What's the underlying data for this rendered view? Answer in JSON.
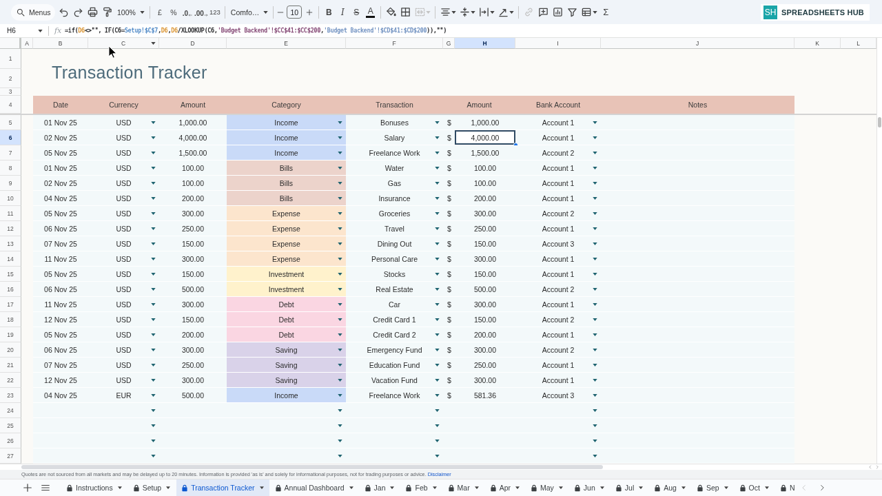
{
  "toolbar": {
    "menu_search": "Menus",
    "zoom": "100%",
    "currency": "£",
    "percent": "%",
    "decrease_decimals": ".0",
    "increase_decimals": ".00",
    "number_format": "123",
    "font": "Comfo…",
    "font_size": "10",
    "bold": "B",
    "italic": "I",
    "strikethrough": "S",
    "text_color": "A",
    "functions": "Σ",
    "merge_disabled": true,
    "link_disabled": true
  },
  "logo": {
    "mark": "SH",
    "name": "SPREADSHEETS HUB"
  },
  "formula_bar": {
    "cell": "H6",
    "fx": "fx",
    "formula": [
      {
        "text": "=if("
      },
      {
        "text": "D6",
        "color": "#d9922e"
      },
      {
        "text": "<>\"\", IF(C6="
      },
      {
        "text": "Setup!$C$7",
        "color": "#4a86c5"
      },
      {
        "text": ","
      },
      {
        "text": "D6",
        "color": "#d9922e"
      },
      {
        "text": ","
      },
      {
        "text": "D6",
        "color": "#d9922e"
      },
      {
        "text": "/XLOOKUP(C6,"
      },
      {
        "text": "'Budget Backend'!$CC$41:$CC$200",
        "color": "#7e3f6e"
      },
      {
        "text": ","
      },
      {
        "text": "'Budget Backend'!$CD$41:$CD$200",
        "color": "#6c8ebf"
      },
      {
        "text": ")),\"\")"
      }
    ]
  },
  "columns": [
    {
      "letter": "A",
      "selected": false,
      "menu": false
    },
    {
      "letter": "B",
      "selected": false,
      "menu": false
    },
    {
      "letter": "C",
      "selected": false,
      "menu": true
    },
    {
      "letter": "D",
      "selected": false,
      "menu": false
    },
    {
      "letter": "E",
      "selected": false,
      "menu": false
    },
    {
      "letter": "F",
      "selected": false,
      "menu": false
    },
    {
      "letter": "G",
      "selected": false,
      "menu": false
    },
    {
      "letter": "H",
      "selected": true,
      "menu": false
    },
    {
      "letter": "I",
      "selected": false,
      "menu": false
    },
    {
      "letter": "J",
      "selected": false,
      "menu": false
    },
    {
      "letter": "K",
      "selected": false,
      "menu": false
    },
    {
      "letter": "L",
      "selected": false,
      "menu": false
    }
  ],
  "top_rows": [
    "1",
    "2",
    "3"
  ],
  "title": "Transaction Tracker",
  "header": {
    "row": "4",
    "labels": [
      "Date",
      "Currency",
      "Amount",
      "Category",
      "Transaction",
      "Amount",
      "Bank Account",
      "Notes"
    ]
  },
  "rows": [
    {
      "row": "5",
      "selected": false,
      "date": "01 Nov 25",
      "currency": "USD",
      "amount": "1,000.00",
      "category": "Income",
      "color": "#c9daf8",
      "transaction": "Bonuses",
      "symbol": "$",
      "dollar_amount": "1,000.00",
      "bank_account": "Account 1"
    },
    {
      "row": "6",
      "selected": true,
      "date": "02 Nov 25",
      "currency": "USD",
      "amount": "4,000.00",
      "category": "Income",
      "color": "#c9daf8",
      "transaction": "Salary",
      "symbol": "$",
      "dollar_amount": "4,000.00",
      "bank_account": "Account 1"
    },
    {
      "row": "7",
      "selected": false,
      "date": "05 Nov 25",
      "currency": "USD",
      "amount": "1,500.00",
      "category": "Income",
      "color": "#c9daf8",
      "transaction": "Freelance Work",
      "symbol": "$",
      "dollar_amount": "1,500.00",
      "bank_account": "Account 2"
    },
    {
      "row": "8",
      "selected": false,
      "date": "01 Nov 25",
      "currency": "USD",
      "amount": "100.00",
      "category": "Bills",
      "color": "#ecd3cb",
      "transaction": "Water",
      "symbol": "$",
      "dollar_amount": "100.00",
      "bank_account": "Account 1"
    },
    {
      "row": "9",
      "selected": false,
      "date": "02 Nov 25",
      "currency": "USD",
      "amount": "100.00",
      "category": "Bills",
      "color": "#ecd3cb",
      "transaction": "Gas",
      "symbol": "$",
      "dollar_amount": "100.00",
      "bank_account": "Account 1"
    },
    {
      "row": "10",
      "selected": false,
      "date": "04 Nov 25",
      "currency": "USD",
      "amount": "200.00",
      "category": "Bills",
      "color": "#ecd3cb",
      "transaction": "Insurance",
      "symbol": "$",
      "dollar_amount": "200.00",
      "bank_account": "Account 1"
    },
    {
      "row": "11",
      "selected": false,
      "date": "05 Nov 25",
      "currency": "USD",
      "amount": "300.00",
      "category": "Expense",
      "color": "#fce5cd",
      "transaction": "Groceries",
      "symbol": "$",
      "dollar_amount": "300.00",
      "bank_account": "Account 2"
    },
    {
      "row": "12",
      "selected": false,
      "date": "06 Nov 25",
      "currency": "USD",
      "amount": "250.00",
      "category": "Expense",
      "color": "#fce5cd",
      "transaction": "Travel",
      "symbol": "$",
      "dollar_amount": "250.00",
      "bank_account": "Account 1"
    },
    {
      "row": "13",
      "selected": false,
      "date": "07 Nov 25",
      "currency": "USD",
      "amount": "150.00",
      "category": "Expense",
      "color": "#fce5cd",
      "transaction": "Dining Out",
      "symbol": "$",
      "dollar_amount": "150.00",
      "bank_account": "Account 3"
    },
    {
      "row": "14",
      "selected": false,
      "date": "11 Nov 25",
      "currency": "USD",
      "amount": "300.00",
      "category": "Expense",
      "color": "#fce5cd",
      "transaction": "Personal Care",
      "symbol": "$",
      "dollar_amount": "300.00",
      "bank_account": "Account 1"
    },
    {
      "row": "15",
      "selected": false,
      "date": "05 Nov 25",
      "currency": "USD",
      "amount": "150.00",
      "category": "Investment",
      "color": "#fff2cc",
      "transaction": "Stocks",
      "symbol": "$",
      "dollar_amount": "150.00",
      "bank_account": "Account 1"
    },
    {
      "row": "16",
      "selected": false,
      "date": "06 Nov 25",
      "currency": "USD",
      "amount": "500.00",
      "category": "Investment",
      "color": "#fff2cc",
      "transaction": "Real Estate",
      "symbol": "$",
      "dollar_amount": "500.00",
      "bank_account": "Account 2"
    },
    {
      "row": "17",
      "selected": false,
      "date": "11 Nov 25",
      "currency": "USD",
      "amount": "300.00",
      "category": "Debt",
      "color": "#fad6e2",
      "transaction": "Car",
      "symbol": "$",
      "dollar_amount": "300.00",
      "bank_account": "Account 1"
    },
    {
      "row": "18",
      "selected": false,
      "date": "12 Nov 25",
      "currency": "USD",
      "amount": "150.00",
      "category": "Debt",
      "color": "#fad6e2",
      "transaction": "Credit Card 1",
      "symbol": "$",
      "dollar_amount": "150.00",
      "bank_account": "Account 2"
    },
    {
      "row": "19",
      "selected": false,
      "date": "05 Nov 25",
      "currency": "USD",
      "amount": "200.00",
      "category": "Debt",
      "color": "#fad6e2",
      "transaction": "Credit Card 2",
      "symbol": "$",
      "dollar_amount": "200.00",
      "bank_account": "Account 1"
    },
    {
      "row": "20",
      "selected": false,
      "date": "06 Nov 25",
      "currency": "USD",
      "amount": "300.00",
      "category": "Saving",
      "color": "#d9d2e9",
      "transaction": "Emergency Fund",
      "symbol": "$",
      "dollar_amount": "300.00",
      "bank_account": "Account 2"
    },
    {
      "row": "21",
      "selected": false,
      "date": "07 Nov 25",
      "currency": "USD",
      "amount": "250.00",
      "category": "Saving",
      "color": "#d9d2e9",
      "transaction": "Education Fund",
      "symbol": "$",
      "dollar_amount": "250.00",
      "bank_account": "Account 1"
    },
    {
      "row": "22",
      "selected": false,
      "date": "12 Nov 25",
      "currency": "USD",
      "amount": "300.00",
      "category": "Saving",
      "color": "#d9d2e9",
      "transaction": "Vacation Fund",
      "symbol": "$",
      "dollar_amount": "300.00",
      "bank_account": "Account 1"
    },
    {
      "row": "23",
      "selected": false,
      "date": "04 Nov 25",
      "currency": "EUR",
      "amount": "500.00",
      "category": "Income",
      "color": "#c9daf8",
      "transaction": "Freelance Work",
      "symbol": "$",
      "dollar_amount": "581.36",
      "bank_account": "Account 3"
    },
    {
      "row": "24",
      "selected": false
    },
    {
      "row": "25",
      "selected": false
    },
    {
      "row": "26",
      "selected": false
    },
    {
      "row": "27",
      "selected": false
    }
  ],
  "disclaimer": {
    "text": "Quotes are not sourced from all markets and may be delayed up to 20 minutes. Information is provided 'as is' and solely for informational purposes, not for trading purposes or advice.",
    "link": "Disclaimer"
  },
  "sheet_tabs": [
    {
      "label": "Instructions",
      "selected": false,
      "caret": true
    },
    {
      "label": "Setup",
      "selected": false,
      "caret": true
    },
    {
      "label": "Transaction Tracker",
      "selected": true,
      "caret": true
    },
    {
      "label": "Annual Dashboard",
      "selected": false,
      "caret": true
    },
    {
      "label": "Jan",
      "selected": false,
      "caret": true
    },
    {
      "label": "Feb",
      "selected": false,
      "caret": true
    },
    {
      "label": "Mar",
      "selected": false,
      "caret": true
    },
    {
      "label": "Apr",
      "selected": false,
      "caret": true
    },
    {
      "label": "May",
      "selected": false,
      "caret": true
    },
    {
      "label": "Jun",
      "selected": false,
      "caret": true
    },
    {
      "label": "Jul",
      "selected": false,
      "caret": true
    },
    {
      "label": "Aug",
      "selected": false,
      "caret": true
    },
    {
      "label": "Sep",
      "selected": false,
      "caret": true
    },
    {
      "label": "Oct",
      "selected": false,
      "caret": true
    },
    {
      "label": "N",
      "selected": false,
      "caret": false
    }
  ],
  "tab_nav": {
    "back_disabled": true,
    "forward_disabled": false
  }
}
